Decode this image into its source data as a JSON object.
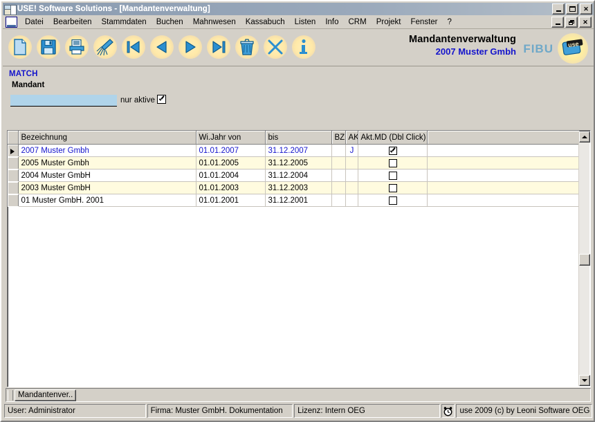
{
  "window": {
    "title": "USE! Software Solutions - [Mandantenverwaltung]",
    "app_icon": "app-window-icon",
    "buttons_outer": [
      {
        "name": "minimize",
        "glyph": "_"
      },
      {
        "name": "maximize",
        "glyph": "□"
      },
      {
        "name": "close",
        "glyph": "×"
      }
    ],
    "buttons_mdi": [
      {
        "name": "minimize",
        "glyph": "_"
      },
      {
        "name": "restore",
        "glyph": "❐"
      },
      {
        "name": "close",
        "glyph": "×"
      }
    ]
  },
  "menubar": {
    "sys_icon": "document-icon",
    "items": [
      {
        "label": "Datei"
      },
      {
        "label": "Bearbeiten"
      },
      {
        "label": "Stammdaten"
      },
      {
        "label": "Buchen"
      },
      {
        "label": "Mahnwesen"
      },
      {
        "label": "Kassabuch"
      },
      {
        "label": "Listen"
      },
      {
        "label": "Info"
      },
      {
        "label": "CRM"
      },
      {
        "label": "Projekt"
      },
      {
        "label": "Fenster"
      },
      {
        "label": "?"
      }
    ]
  },
  "toolbar": {
    "buttons": [
      {
        "icon": "new-document-icon",
        "name": "new"
      },
      {
        "icon": "save-floppy-icon",
        "name": "save"
      },
      {
        "icon": "print-icon",
        "name": "print"
      },
      {
        "icon": "broom-clear-icon",
        "name": "clear"
      },
      {
        "icon": "first-record-icon",
        "name": "first"
      },
      {
        "icon": "previous-record-icon",
        "name": "previous"
      },
      {
        "icon": "next-record-icon",
        "name": "next"
      },
      {
        "icon": "last-record-icon",
        "name": "last"
      },
      {
        "icon": "trash-delete-icon",
        "name": "delete"
      },
      {
        "icon": "cancel-x-icon",
        "name": "cancel"
      },
      {
        "icon": "info-icon",
        "name": "info"
      }
    ]
  },
  "header": {
    "title": "Mandantenverwaltung",
    "subtitle": "2007 Muster Gmbh",
    "module_badge": "FIBU",
    "logo_text": "use",
    "accent_blue": "#1414cc",
    "badge_color": "#6fa8c8"
  },
  "match": {
    "section_label": "MATCH",
    "field_label": "Mandant",
    "input_value": "",
    "input_placeholder": "",
    "checkbox_label": "nur aktive",
    "checkbox_checked": true
  },
  "grid": {
    "columns": [
      {
        "key": "gutter",
        "label": ""
      },
      {
        "key": "bezeichnung",
        "label": "Bezeichnung"
      },
      {
        "key": "von",
        "label": "Wi.Jahr von"
      },
      {
        "key": "bis",
        "label": "bis"
      },
      {
        "key": "bz",
        "label": "BZ"
      },
      {
        "key": "ak",
        "label": "AK"
      },
      {
        "key": "aktmd",
        "label": "Akt.MD (Dbl Click)"
      },
      {
        "key": "pad",
        "label": ""
      }
    ],
    "rows": [
      {
        "bezeichnung": "2007 Muster Gmbh",
        "von": "01.01.2007",
        "bis": "31.12.2007",
        "bz": "",
        "ak": "J",
        "aktmd": true,
        "selected": true
      },
      {
        "bezeichnung": "2005 Muster Gmbh",
        "von": "01.01.2005",
        "bis": "31.12.2005",
        "bz": "",
        "ak": "",
        "aktmd": false,
        "selected": false
      },
      {
        "bezeichnung": "2004 Muster GmbH",
        "von": "01.01.2004",
        "bis": "31.12.2004",
        "bz": "",
        "ak": "",
        "aktmd": false,
        "selected": false
      },
      {
        "bezeichnung": "2003 Muster GmbH",
        "von": "01.01.2003",
        "bis": "31.12.2003",
        "bz": "",
        "ak": "",
        "aktmd": false,
        "selected": false
      },
      {
        "bezeichnung": "01 Muster GmbH. 2001",
        "von": "01.01.2001",
        "bis": "31.12.2001",
        "bz": "",
        "ak": "",
        "aktmd": false,
        "selected": false
      }
    ],
    "selection_color": "#18246e",
    "alt_row_color": "#fffbdf",
    "scrollbar": {
      "up_icon": "arrow-up-icon",
      "down_icon": "arrow-down-icon"
    }
  },
  "taskbar": {
    "buttons": [
      {
        "label": "Mandantenver.."
      }
    ]
  },
  "statusbar": {
    "user": "User: Administrator",
    "firma": "Firma: Muster GmbH. Dokumentation",
    "lizenz": "Lizenz: Intern OEG",
    "clock_icon": "alarm-clock-icon",
    "copyright": "use 2009 (c) by Leoni Software OEG"
  }
}
